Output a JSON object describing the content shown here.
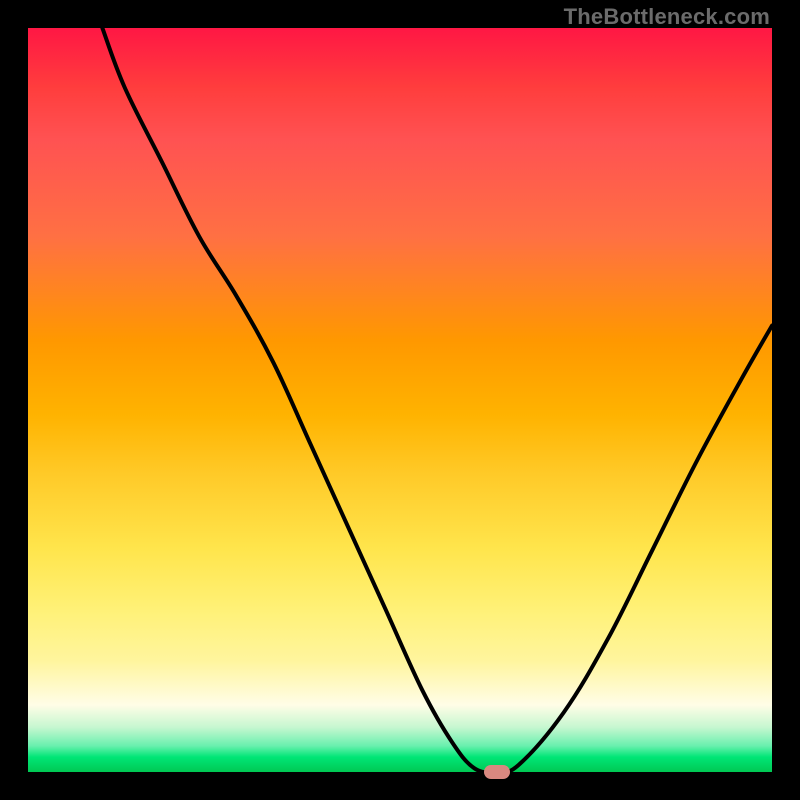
{
  "watermark": "TheBottleneck.com",
  "chart_data": {
    "type": "line",
    "title": "",
    "xlabel": "",
    "ylabel": "",
    "xlim": [
      0,
      100
    ],
    "ylim": [
      0,
      100
    ],
    "gradient_stops": [
      {
        "pct": 0,
        "color": "#ff1744"
      },
      {
        "pct": 8,
        "color": "#ff3d3d"
      },
      {
        "pct": 15,
        "color": "#ff5252"
      },
      {
        "pct": 28,
        "color": "#ff7043"
      },
      {
        "pct": 42,
        "color": "#ff9800"
      },
      {
        "pct": 52,
        "color": "#ffb300"
      },
      {
        "pct": 60,
        "color": "#ffca28"
      },
      {
        "pct": 70,
        "color": "#ffe54c"
      },
      {
        "pct": 78,
        "color": "#fff176"
      },
      {
        "pct": 85,
        "color": "#fff59d"
      },
      {
        "pct": 91,
        "color": "#fffde7"
      },
      {
        "pct": 94,
        "color": "#c6f7d0"
      },
      {
        "pct": 96.5,
        "color": "#69f0ae"
      },
      {
        "pct": 98,
        "color": "#00e676"
      },
      {
        "pct": 100,
        "color": "#00c853"
      }
    ],
    "series": [
      {
        "name": "bottleneck-curve",
        "x": [
          10,
          13,
          18,
          23,
          28,
          33,
          38,
          43,
          48,
          53,
          57,
          60,
          63,
          66,
          72,
          78,
          84,
          90,
          96,
          100
        ],
        "y": [
          100,
          92,
          82,
          72,
          64,
          55,
          44,
          33,
          22,
          11,
          4,
          0.5,
          0,
          1,
          8,
          18,
          30,
          42,
          53,
          60
        ]
      }
    ],
    "marker": {
      "x": 63,
      "y": 0,
      "color": "#d98880"
    }
  }
}
